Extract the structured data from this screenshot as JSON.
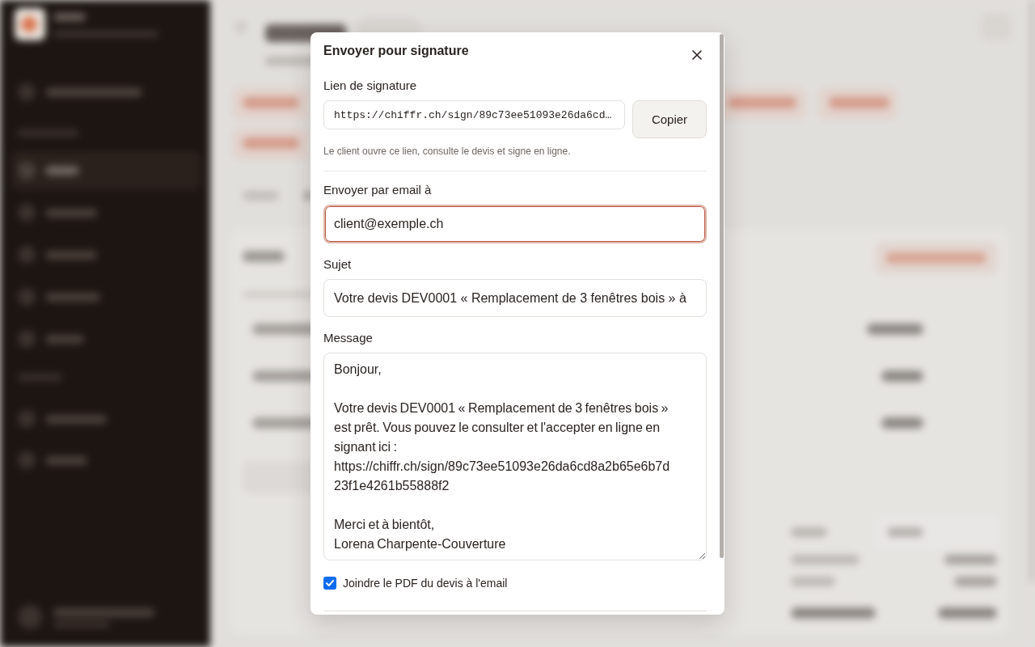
{
  "dialog": {
    "title": "Envoyer pour signature",
    "link": {
      "label": "Lien de signature",
      "value": "https://chiffr.ch/sign/89c73ee51093e26da6cd…",
      "button": "Copier",
      "hint": "Le client ouvre ce lien, consulte le devis et signe en ligne."
    },
    "email": {
      "label": "Envoyer par email à",
      "value": "client@exemple.ch",
      "focused": true
    },
    "subject": {
      "label": "Sujet",
      "value": "Votre devis DEV0001 « Remplacement de 3 fenêtres bois » à",
      "focused": false
    },
    "message": {
      "label": "Message",
      "value": "Bonjour,\n\nVotre devis DEV0001 « Remplacement de 3 fenêtres bois » est prêt. Vous pouvez le consulter et l'accepter en ligne en signant ici :\nhttps://chiffr.ch/sign/89c73ee51093e26da6cd8a2b65e6b7d23f1e4261b55888f2\n\nMerci et à bientôt,\nLorena Charpente-Couverture"
    },
    "attach_pdf": {
      "label": "Joindre le PDF du devis à l'email",
      "checked": true
    }
  }
}
